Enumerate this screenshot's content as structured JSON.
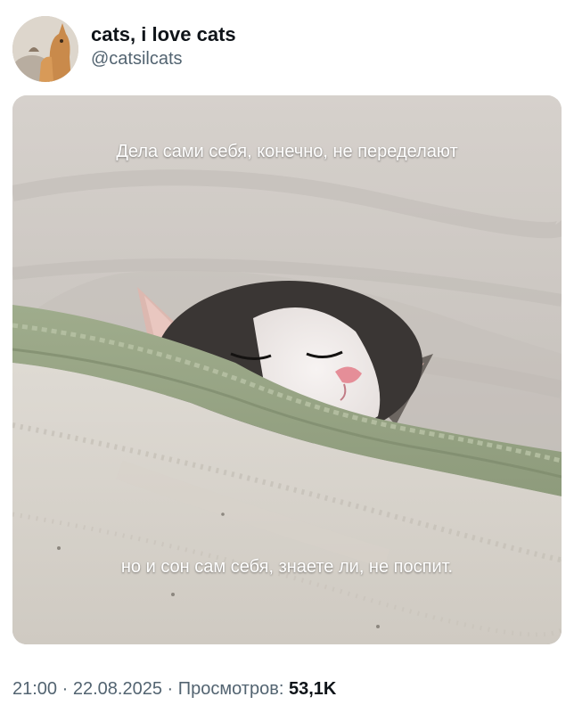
{
  "author": {
    "display_name": "cats, i love cats",
    "handle": "@catsilcats",
    "avatar_icon": "cat-avatar-icon"
  },
  "media": {
    "caption_top": "Дела сами себя, конечно, не переделают",
    "caption_bottom": "но и сон сам себя, знаете ли, не поспит.",
    "image_icon": "sleeping-kitten-photo"
  },
  "meta": {
    "time": "21:00",
    "separator_1": " · ",
    "date": "22.08.2025",
    "separator_2": " · ",
    "views_label": "Просмотров:",
    "views_count": "53,1K"
  },
  "colors": {
    "text_primary": "#0f1419",
    "text_secondary": "#536471",
    "caption_text": "#ffffff"
  }
}
